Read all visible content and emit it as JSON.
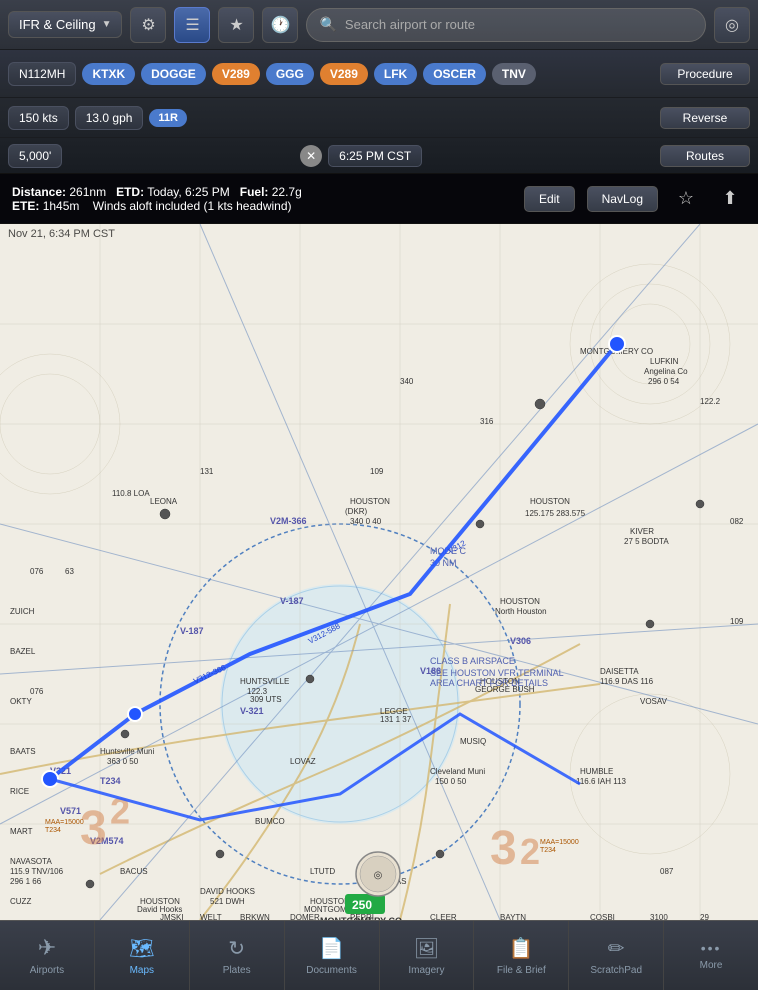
{
  "topNav": {
    "dropdown_label": "IFR & Ceiling",
    "search_placeholder": "Search airport or route"
  },
  "routeBar": {
    "aircraft": "N112MH",
    "waypoints": [
      {
        "id": "KTXK",
        "type": "blue"
      },
      {
        "id": "DOGGE",
        "type": "blue"
      },
      {
        "id": "V289",
        "type": "orange"
      },
      {
        "id": "GGG",
        "type": "blue"
      },
      {
        "id": "V289",
        "type": "orange"
      },
      {
        "id": "LFK",
        "type": "blue"
      },
      {
        "id": "OSCER",
        "type": "blue"
      },
      {
        "id": "TNV",
        "type": "gray"
      }
    ],
    "procedure_btn": "Procedure",
    "reverse_btn": "Reverse",
    "routes_btn": "Routes"
  },
  "secondRow": {
    "speed": "150 kts",
    "fuel": "13.0 gph",
    "waypoint": {
      "id": "11R",
      "type": "blue"
    }
  },
  "altitudeRow": {
    "altitude": "5,000'",
    "time": "6:25 PM CST"
  },
  "infoBar": {
    "distance_label": "Distance:",
    "distance_value": "261nm",
    "etd_label": "ETD:",
    "etd_value": "Today, 6:25 PM",
    "fuel_label": "Fuel:",
    "fuel_value": "22.7g",
    "ete_label": "ETE:",
    "ete_value": "1h45m",
    "winds_note": "Winds aloft included (1 kts headwind)",
    "edit_btn": "Edit",
    "navlog_btn": "NavLog"
  },
  "mapTimestamp": "Nov 21, 6:34 PM CST",
  "bottomNav": [
    {
      "id": "airports",
      "label": "Airports",
      "icon": "✈",
      "active": false
    },
    {
      "id": "maps",
      "label": "Maps",
      "icon": "🗺",
      "active": true
    },
    {
      "id": "plates",
      "label": "Plates",
      "icon": "↻",
      "active": false
    },
    {
      "id": "documents",
      "label": "Documents",
      "icon": "📄",
      "active": false
    },
    {
      "id": "imagery",
      "label": "Imagery",
      "icon": "🖼",
      "active": false
    },
    {
      "id": "filebrief",
      "label": "File & Brief",
      "icon": "📋",
      "active": false
    },
    {
      "id": "scratchpad",
      "label": "ScratchPad",
      "icon": "✏",
      "active": false
    },
    {
      "id": "more",
      "label": "More",
      "icon": "•••",
      "active": false
    }
  ]
}
